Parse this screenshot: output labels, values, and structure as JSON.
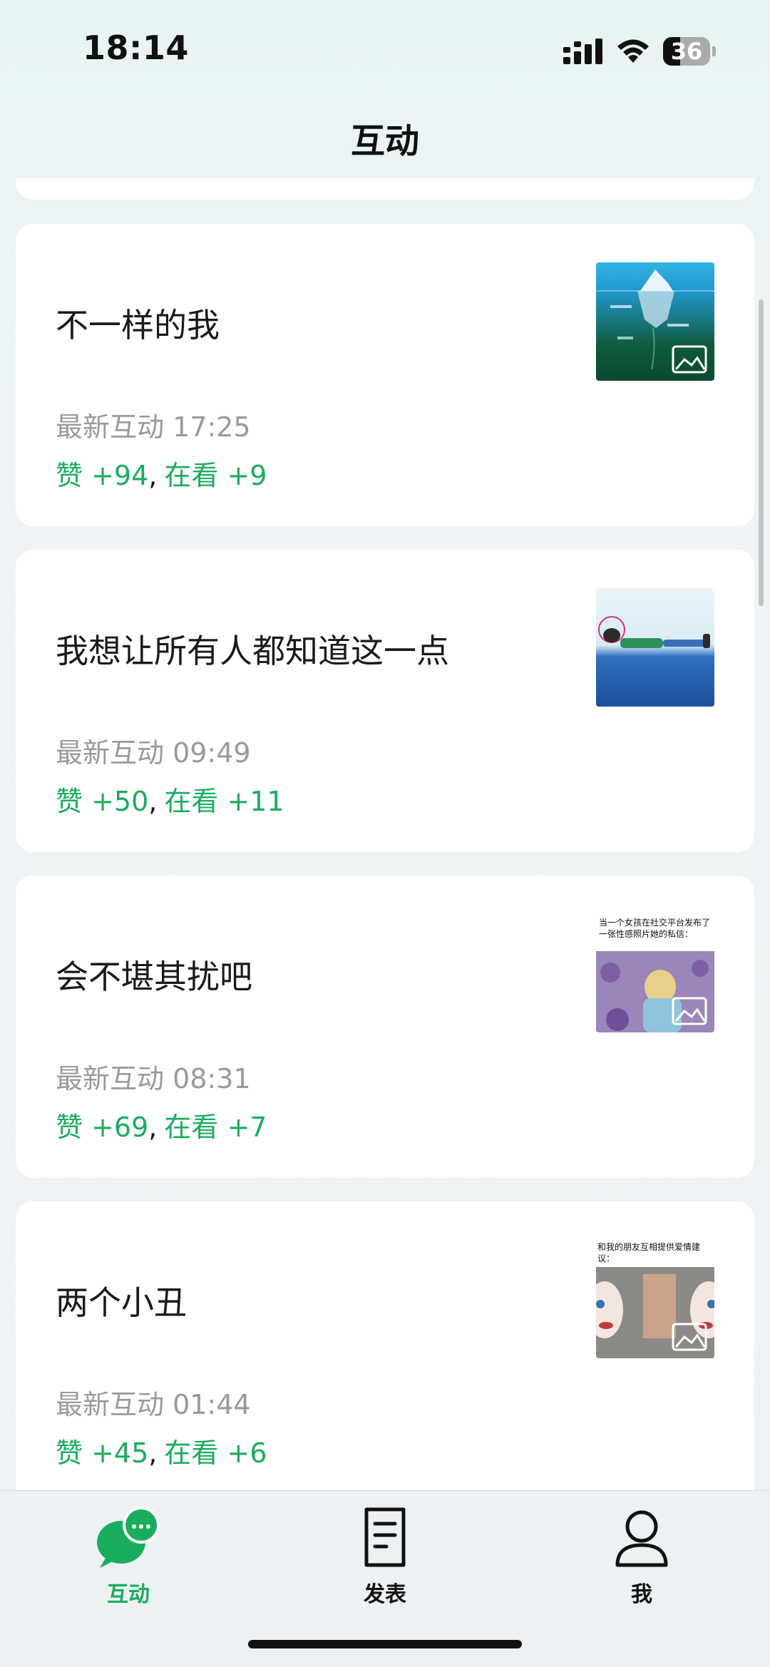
{
  "status_bar": {
    "time": "18:14",
    "battery_level": "36",
    "battery_fraction": 0.36,
    "icons": [
      "signal-icon",
      "wifi-icon",
      "battery-icon"
    ]
  },
  "nav": {
    "title": "互动"
  },
  "colors": {
    "accent": "#1aad5e",
    "muted": "#9a9a9a",
    "background": "#eaf4f4"
  },
  "posts": [
    {
      "title": "不一样的我",
      "latest_label": "最新互动 17:25",
      "likes": "赞 +94",
      "separator": ",",
      "views": "在看 +9",
      "thumb_icon": "image-icon"
    },
    {
      "title": "我想让所有人都知道这一点",
      "latest_label": "最新互动 09:49",
      "likes": "赞 +50",
      "separator": ",",
      "views": "在看 +11",
      "thumb_icon": "image-icon"
    },
    {
      "title": "会不堪其扰吧",
      "latest_label": "最新互动 08:31",
      "likes": "赞 +69",
      "separator": ",",
      "views": "在看 +7",
      "thumb_caption": "当一个女孩在社交平台发布了一张性感照片她的私信：",
      "thumb_icon": "image-icon"
    },
    {
      "title": "两个小丑",
      "latest_label": "最新互动 01:44",
      "likes": "赞 +45",
      "separator": ",",
      "views": "在看 +6",
      "thumb_caption": "和我的朋友互相提供爱情建议：",
      "thumb_icon": "image-icon"
    }
  ],
  "tab_bar": {
    "tabs": [
      {
        "label": "互动",
        "icon": "chat-bubbles-icon",
        "active": true
      },
      {
        "label": "发表",
        "icon": "document-icon",
        "active": false
      },
      {
        "label": "我",
        "icon": "person-icon",
        "active": false
      }
    ]
  }
}
